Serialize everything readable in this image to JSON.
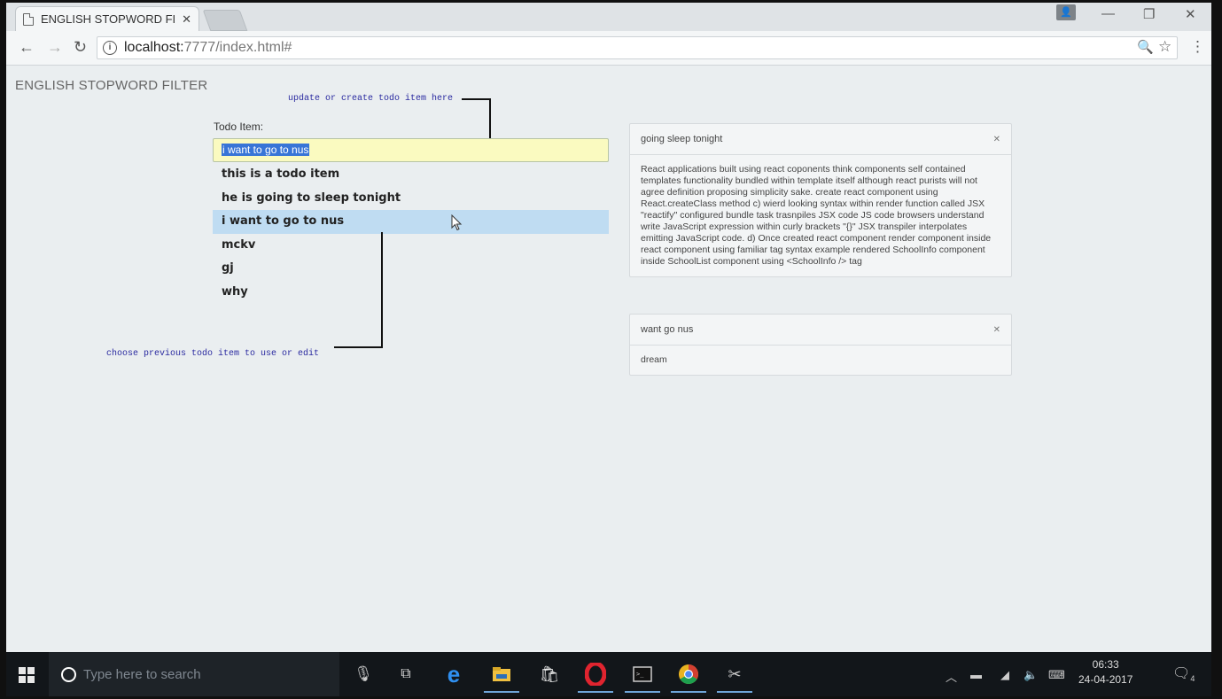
{
  "browser": {
    "tab_title": "ENGLISH STOPWORD FIL",
    "url_host": "localhost:",
    "url_path": "7777/index.html#"
  },
  "page": {
    "brand": "ENGLISH STOPWORD FILTER",
    "todo_label": "Todo Item:",
    "todo_input_value": "i want to go to nus",
    "todo_items": [
      "this is a todo item",
      "he is going to sleep tonight",
      "i want to go to nus",
      "mckv",
      "gj",
      "why"
    ],
    "annotations": {
      "update": "update or create todo item here",
      "choose": "choose previous todo item to use or edit"
    },
    "panels": [
      {
        "title": "going sleep tonight",
        "body": "React applications built using react coponents think components self contained templates functionality bundled within template itself although react purists will not agree definition proposing simplicity sake. create react component using React.createClass method c) wierd looking syntax within render function called JSX \"reactify\" configured bundle task trasnpiles JSX code JS code browsers understand write JavaScript expression within curly brackets \"{}\" JSX transpiler interpolates emitting JavaScript code. d) Once created react component render component inside react component using familiar tag syntax example rendered SchoolInfo component inside SchoolList component using <SchoolInfo /> tag"
      },
      {
        "title": "want go nus",
        "body": "dream"
      }
    ]
  },
  "taskbar": {
    "search_placeholder": "Type here to search",
    "time": "06:33",
    "date": "24-04-2017",
    "notification_count": "4"
  },
  "colors": {
    "input_highlight": "#fafac0",
    "selected_row": "#bfdcf2",
    "annotation_text": "#2a2aa0"
  }
}
